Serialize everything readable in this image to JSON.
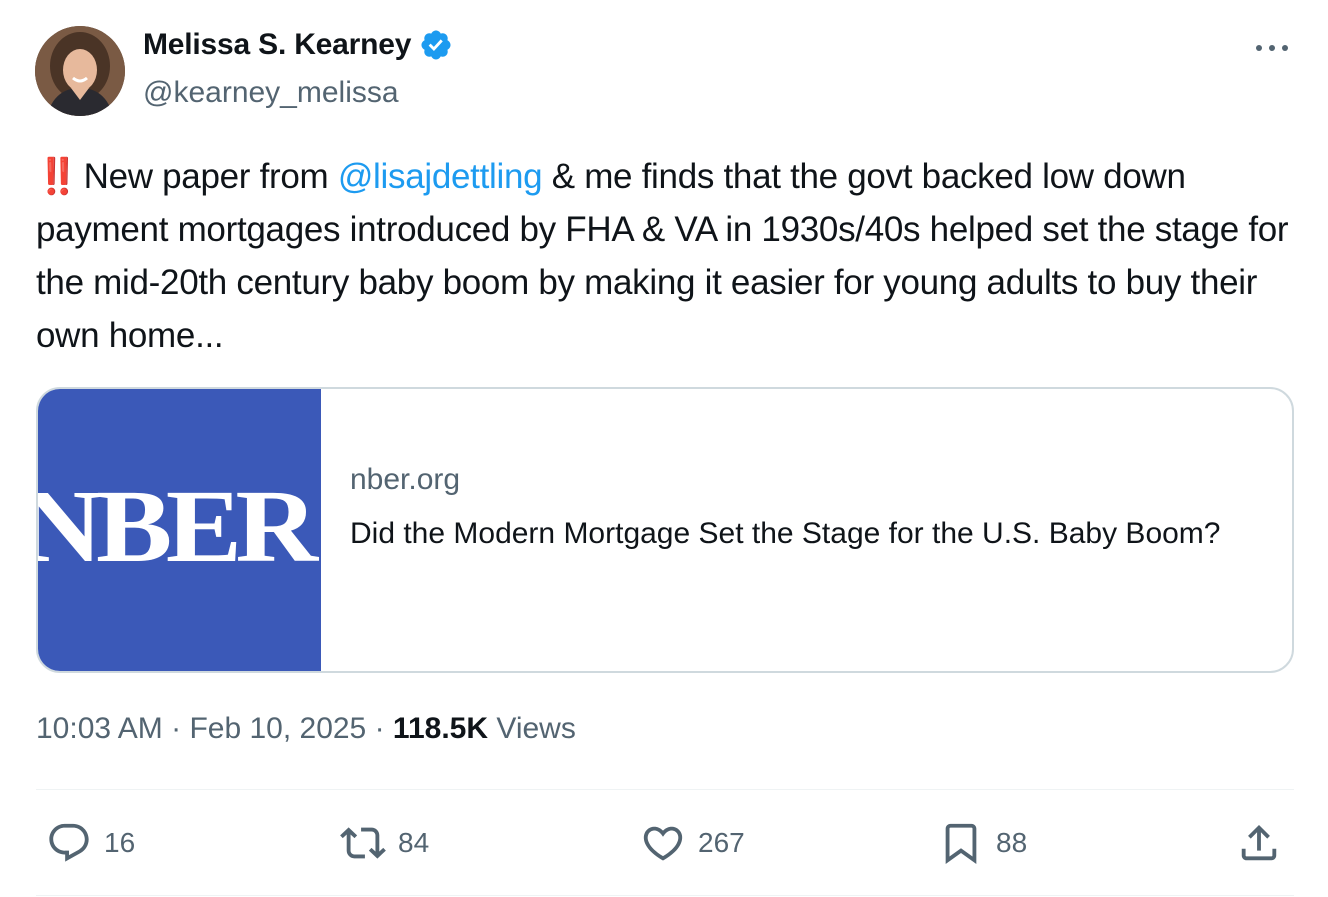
{
  "author": {
    "name": "Melissa S. Kearney",
    "handle": "@kearney_melissa",
    "verified": true,
    "badge_color": "#1d9bf0"
  },
  "tweet": {
    "emoji": "‼️",
    "text_before_mention": "New paper from ",
    "mention": "@lisajdettling",
    "text_after_mention": " & me finds that the govt backed low down payment mortgages introduced by FHA & VA in 1930s/40s helped set the stage for the mid-20th century baby boom by making it easier for young adults to buy their own home..."
  },
  "card": {
    "image_logo_text": "NBER",
    "image_bg_color": "#3b59b8",
    "domain": "nber.org",
    "title": "Did the Modern Mortgage Set the Stage for the U.S. Baby Boom?"
  },
  "meta": {
    "time": "10:03 AM",
    "separator": " · ",
    "date": "Feb 10, 2025",
    "views_count": "118.5K",
    "views_label": " Views"
  },
  "actions": {
    "replies": "16",
    "retweets": "84",
    "likes": "267",
    "bookmarks": "88",
    "share_icon": "share-icon"
  }
}
